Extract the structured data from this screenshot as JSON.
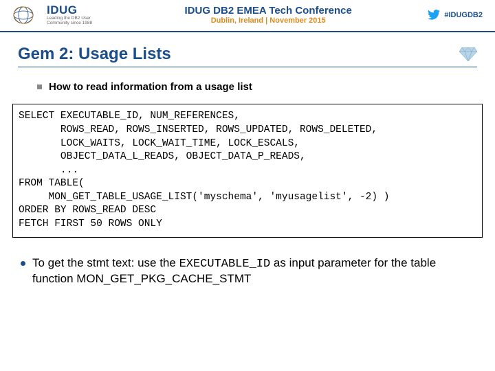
{
  "header": {
    "logo_name": "IDUG",
    "logo_tagline": "Leading the DB2 User Community since 1988",
    "conference_title": "IDUG DB2 EMEA Tech Conference",
    "conference_sub": "Dublin, Ireland | November 2015",
    "hashtag": "#IDUGDB2"
  },
  "slide": {
    "title": "Gem 2: Usage Lists",
    "bullet1": "How to read information from a usage list",
    "code": "SELECT EXECUTABLE_ID, NUM_REFERENCES,\n       ROWS_READ, ROWS_INSERTED, ROWS_UPDATED, ROWS_DELETED,\n       LOCK_WAITS, LOCK_WAIT_TIME, LOCK_ESCALS,\n       OBJECT_DATA_L_READS, OBJECT_DATA_P_READS,\n       ...\nFROM TABLE(\n     MON_GET_TABLE_USAGE_LIST('myschema', 'myusagelist', -2) )\nORDER BY ROWS_READ DESC\nFETCH FIRST 50 ROWS ONLY",
    "note_prefix": "To get the stmt text: use the ",
    "note_mono": "EXECUTABLE_ID",
    "note_suffix": " as input parameter for the table function MON_GET_PKG_CACHE_STMT"
  }
}
